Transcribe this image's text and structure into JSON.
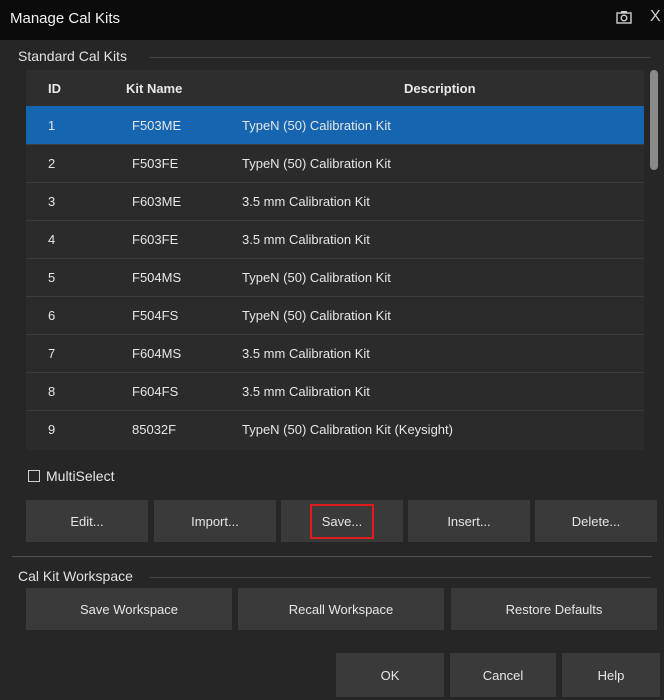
{
  "window": {
    "title": "Manage Cal Kits",
    "camera_icon": "camera-icon",
    "close_glyph": "X"
  },
  "standard_section": {
    "label": "Standard Cal Kits",
    "columns": [
      "ID",
      "Kit Name",
      "Description"
    ],
    "rows": [
      {
        "id": "1",
        "name": "F503ME",
        "desc": "TypeN (50) Calibration Kit"
      },
      {
        "id": "2",
        "name": "F503FE",
        "desc": "TypeN (50) Calibration Kit"
      },
      {
        "id": "3",
        "name": "F603ME",
        "desc": "3.5 mm Calibration Kit"
      },
      {
        "id": "4",
        "name": "F603FE",
        "desc": "3.5 mm Calibration Kit"
      },
      {
        "id": "5",
        "name": "F504MS",
        "desc": "TypeN (50) Calibration Kit"
      },
      {
        "id": "6",
        "name": "F504FS",
        "desc": "TypeN (50) Calibration Kit"
      },
      {
        "id": "7",
        "name": "F604MS",
        "desc": "3.5 mm Calibration Kit"
      },
      {
        "id": "8",
        "name": "F604FS",
        "desc": "3.5 mm Calibration Kit"
      },
      {
        "id": "9",
        "name": "85032F",
        "desc": "TypeN (50) Calibration Kit (Keysight)"
      }
    ],
    "selected_row_index": 0,
    "multiselect_label": "MultiSelect",
    "multiselect_checked": false,
    "buttons": {
      "edit": "Edit...",
      "import": "Import...",
      "save": "Save...",
      "insert": "Insert...",
      "delete": "Delete..."
    }
  },
  "workspace_section": {
    "label": "Cal Kit Workspace",
    "buttons": {
      "save_workspace": "Save Workspace",
      "recall_workspace": "Recall Workspace",
      "restore_defaults": "Restore Defaults"
    }
  },
  "footer": {
    "ok": "OK",
    "cancel": "Cancel",
    "help": "Help"
  },
  "colors": {
    "selection": "#1565b0",
    "highlight_border": "#e11b1b",
    "background": "#262626",
    "button": "#3a3a3a"
  }
}
